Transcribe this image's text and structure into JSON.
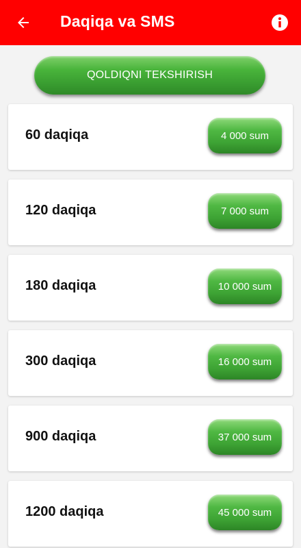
{
  "header": {
    "title": "Daqiqa va SMS",
    "back_icon": "arrow-left-icon",
    "info_icon": "info-icon"
  },
  "check_button": {
    "label": "QOLDIQNI TEKSHIRISH"
  },
  "packages": [
    {
      "label": "60 daqiqa",
      "price": "4 000 sum"
    },
    {
      "label": "120 daqiqa",
      "price": "7 000 sum"
    },
    {
      "label": "180 daqiqa",
      "price": "10 000 sum"
    },
    {
      "label": "300 daqiqa",
      "price": "16 000 sum"
    },
    {
      "label": "900 daqiqa",
      "price": "37 000 sum"
    },
    {
      "label": "1200 daqiqa",
      "price": "45 000 sum"
    }
  ],
  "colors": {
    "header_bg": "#ff0000",
    "button_green": "#49b43b",
    "background": "#f3f3f3"
  }
}
